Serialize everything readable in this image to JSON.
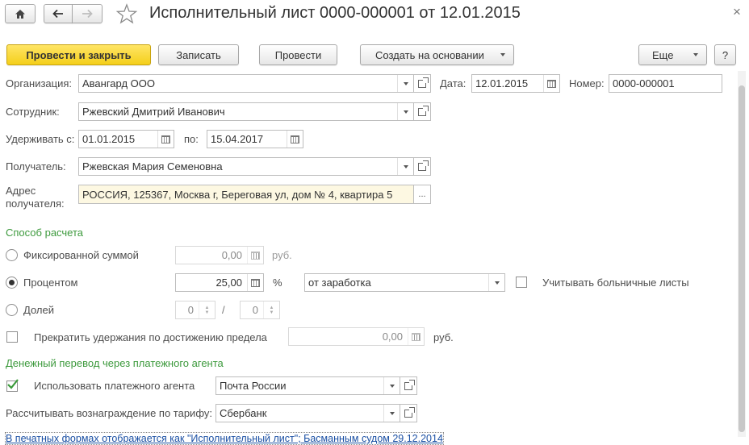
{
  "window": {
    "title": "Исполнительный лист 0000-000001 от 12.01.2015",
    "close_glyph": "×",
    "home_glyph": "⌂",
    "back_glyph": "←",
    "forward_glyph": "→",
    "star_glyph": "☆"
  },
  "toolbar": {
    "post_close": "Провести и закрыть",
    "save": "Записать",
    "post": "Провести",
    "create_based": "Создать на основании",
    "more": "Еще",
    "help": "?"
  },
  "form": {
    "org_label": "Организация:",
    "org_value": "Авангард ООО",
    "date_label": "Дата:",
    "date_value": "12.01.2015",
    "number_label": "Номер:",
    "number_value": "0000-000001",
    "employee_label": "Сотрудник:",
    "employee_value": "Ржевский Дмитрий Иванович",
    "withhold_from_label": "Удерживать с:",
    "withhold_from_value": "01.01.2015",
    "to_label": "по:",
    "to_value": "15.04.2017",
    "recipient_label": "Получатель:",
    "recipient_value": "Ржевская Мария Семеновна",
    "address_label_1": "Адрес",
    "address_label_2": "получателя:",
    "address_value": "РОССИЯ, 125367, Москва г, Береговая ул, дом № 4, квартира 5",
    "address_btn": "..."
  },
  "calc": {
    "section_title": "Способ расчета",
    "fixed_label": "Фиксированной суммой",
    "fixed_value": "0,00",
    "fixed_unit": "руб.",
    "percent_label": "Процентом",
    "percent_value": "25,00",
    "percent_unit": "%",
    "base_value": "от заработка",
    "sick_leave_label": "Учитывать больничные листы",
    "share_label": "Долей",
    "share_num": "0",
    "share_sep": "/",
    "share_den": "0",
    "stop_label": "Прекратить удержания по достижению предела",
    "stop_value": "0,00",
    "stop_unit": "руб."
  },
  "agent": {
    "section_title": "Денежный перевод через платежного агента",
    "use_agent_label": "Использовать платежного агента",
    "agent_value": "Почта России",
    "tariff_label": "Рассчитывать вознаграждение по тарифу:",
    "tariff_value": "Сбербанк"
  },
  "footer": {
    "link_text": "В печатных формах отображается как \"Исполнительный лист\"; Басманным судом 29.12.2014"
  },
  "options": {
    "method_selected": "percent",
    "use_agent_checked": true,
    "sick_leave_checked": false,
    "stop_checked": false
  },
  "colors": {
    "section_green": "#3d9a3d",
    "primary_button": "#f4cf1a",
    "link_blue": "#1a4fa3",
    "checkmark_green": "#3a9a3a",
    "address_background": "#fdf8e2"
  }
}
